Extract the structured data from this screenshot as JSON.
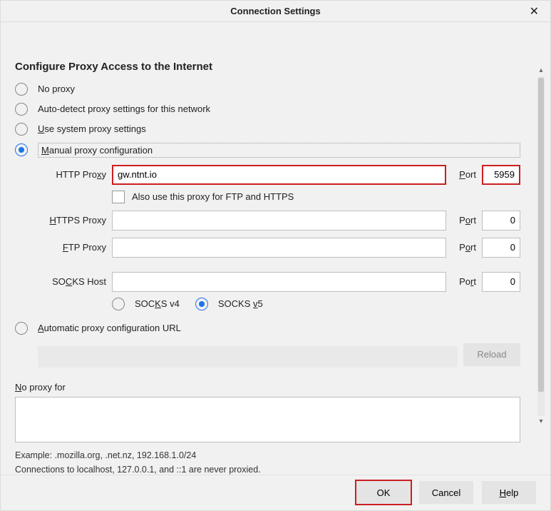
{
  "title": "Connection Settings",
  "heading": "Configure Proxy Access to the Internet",
  "radios": {
    "no_proxy": "No proxy",
    "auto_detect": "Auto-detect proxy settings for this network",
    "use_system": "Use system proxy settings",
    "manual": "Manual proxy configuration",
    "auto_url": "Automatic proxy configuration URL"
  },
  "proxy": {
    "http_label": "HTTP Proxy",
    "http_value": "gw.ntnt.io",
    "http_port": "5959",
    "also_label": "Also use this proxy for FTP and HTTPS",
    "https_label": "HTTPS Proxy",
    "https_value": "",
    "https_port": "0",
    "ftp_label": "FTP Proxy",
    "ftp_value": "",
    "ftp_port": "0",
    "socks_label": "SOCKS Host",
    "socks_value": "",
    "socks_port": "0",
    "port_label": "Port",
    "socks_v4": "SOCKS v4",
    "socks_v5": "SOCKS v5"
  },
  "pac": {
    "value": "",
    "reload": "Reload"
  },
  "no_proxy_for": {
    "label": "No proxy for",
    "value": "",
    "example": "Example: .mozilla.org, .net.nz, 192.168.1.0/24",
    "note": "Connections to localhost, 127.0.0.1, and ::1 are never proxied."
  },
  "buttons": {
    "ok": "OK",
    "cancel": "Cancel",
    "help": "Help"
  }
}
